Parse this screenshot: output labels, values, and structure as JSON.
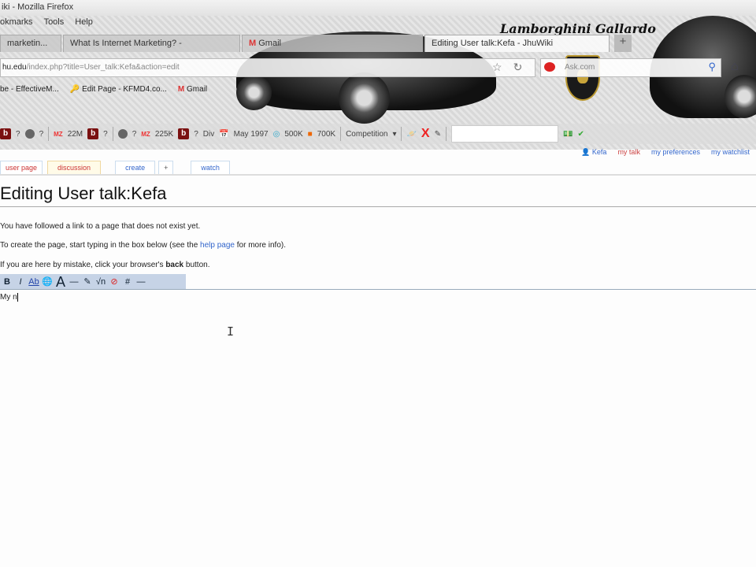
{
  "window": {
    "title": "iki - Mozilla Firefox"
  },
  "menu": [
    "okmarks",
    "Tools",
    "Help"
  ],
  "brand": "Lamborghini Gallardo",
  "tabs": [
    {
      "label": "marketin..."
    },
    {
      "label": "What Is Internet Marketing? -"
    },
    {
      "label": "Gmail"
    },
    {
      "label": "Editing User talk:Kefa - JhuWiki"
    }
  ],
  "url": {
    "host": "hu.edu",
    "path": "/index.php?title=User_talk:Kefa&action=edit"
  },
  "search": {
    "placeholder": "Ask.com"
  },
  "bookmarks": [
    "be - EffectiveM...",
    "Edit Page - KFMD4.co...",
    "Gmail"
  ],
  "toolbar": {
    "items": [
      "?",
      "?",
      "22M",
      "?",
      "?",
      "225K",
      "?",
      "Div",
      "May 1997",
      "500K",
      "700K",
      "Competition"
    ]
  },
  "wiki": {
    "tabs": [
      "user page",
      "discussion",
      "create",
      "+",
      "watch"
    ],
    "personal": [
      "Kefa",
      "my talk",
      "my preferences",
      "my watchlist"
    ],
    "heading": "Editing User talk:Kefa",
    "p1": "You have followed a link to a page that does not exist yet.",
    "p2a": "To create the page, start typing in the box below (see the ",
    "p2link": "help page",
    "p2b": " for more info).",
    "p3a": "If you are here by mistake, click your browser's ",
    "p3b": "back",
    "p3c": " button.",
    "editor_buttons": [
      "B",
      "I",
      "Ab",
      "🌐",
      "A",
      "—",
      "✎",
      "√n",
      "⊘",
      "#",
      "—"
    ],
    "text": "My n"
  }
}
